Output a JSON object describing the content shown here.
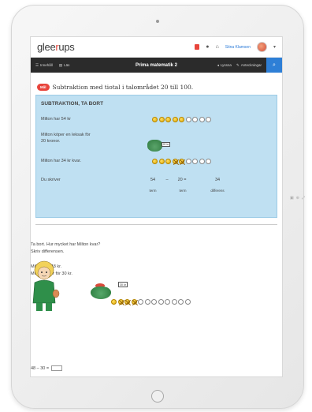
{
  "header": {
    "logo_prefix": "glee",
    "logo_accent": "r",
    "logo_suffix": "ups",
    "user_name": "Stina Klamsen"
  },
  "toolbar": {
    "left_items": [
      "Innehåll",
      "Läs"
    ],
    "title": "Prima matematik 2",
    "right_items": [
      "Lyssna",
      "Anteckningar"
    ]
  },
  "task": {
    "badge": "Mål",
    "title": "Subtraktion med tiotal i talområdet 20 till 100."
  },
  "example": {
    "heading": "SUBTRAKTION, TA BORT",
    "line1": "Milton har 54 kr",
    "line2a": "Milton köper en leksak för",
    "line2b": "20 kronor.",
    "line3": "Milton har 34 kr kvar.",
    "line4": "Du skriver",
    "price_tag": "20 kr",
    "equation": [
      "54",
      "–",
      "20 =",
      "34"
    ],
    "labels": [
      "term",
      "term",
      "differens"
    ]
  },
  "exercise": {
    "line1": "Ta bort. Hur mycket har Milton kvar?",
    "line2": "Skriv differensen.",
    "line3": "Milton har 48 kr.",
    "line4": "Milton köper för 30 kr.",
    "price_tag": "30 kr",
    "answer_prompt": "48 – 30 ="
  },
  "coins": {
    "example_row1": {
      "filled": 5,
      "empty": 4,
      "crossed": 0
    },
    "example_row2": {
      "filled": 5,
      "empty": 4,
      "crossed": 2
    },
    "exercise_row": {
      "filled": 4,
      "empty": 8,
      "crossed": 3
    }
  },
  "colors": {
    "accent_red": "#e8453c",
    "toolbar_bg": "#2b2b2b",
    "toolbar_blue": "#2e7fd6",
    "example_bg": "#bfe0f2"
  }
}
